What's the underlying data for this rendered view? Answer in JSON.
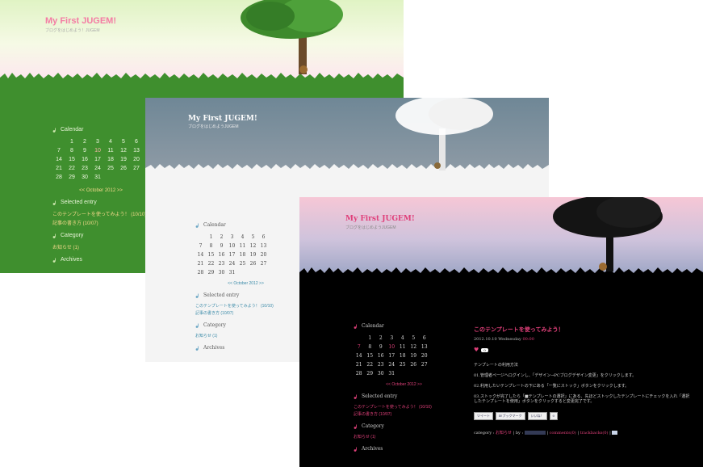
{
  "theme_spring": {
    "title": "My First JUGEM!",
    "subtitle": "ブログをはじめよう！JUGEM",
    "calendar_heading": "Calendar",
    "calendar_rows": [
      [
        "",
        "",
        "1",
        "2",
        "3",
        "4",
        "5",
        "6"
      ],
      [
        "7",
        "8",
        "9",
        "10",
        "11",
        "12",
        "13"
      ],
      [
        "14",
        "15",
        "16",
        "17",
        "18",
        "19",
        "20"
      ],
      [
        "21",
        "22",
        "23",
        "24",
        "25",
        "26",
        "27"
      ],
      [
        "28",
        "29",
        "30",
        "31",
        "",
        "",
        ""
      ]
    ],
    "calendar_nav": "<< October 2012 >>",
    "selected_heading": "Selected entry",
    "selected_items": [
      "このテンプレートを使ってみよう！ (10/10)",
      "記事の書き方 (10/07)"
    ],
    "category_heading": "Category",
    "category_items": [
      "お知らせ (1)"
    ],
    "archives_heading": "Archives"
  },
  "theme_winter": {
    "title": "My First JUGEM!",
    "subtitle": "ブログをはじめようJUGEM",
    "calendar_heading": "Calendar",
    "calendar_rows": [
      [
        "",
        "",
        "1",
        "2",
        "3",
        "4",
        "5",
        "6"
      ],
      [
        "7",
        "8",
        "9",
        "10",
        "11",
        "12",
        "13"
      ],
      [
        "14",
        "15",
        "16",
        "17",
        "18",
        "19",
        "20"
      ],
      [
        "21",
        "22",
        "23",
        "24",
        "25",
        "26",
        "27"
      ],
      [
        "28",
        "29",
        "30",
        "31",
        "",
        "",
        ""
      ]
    ],
    "calendar_nav": "<< October 2012 >>",
    "selected_heading": "Selected entry",
    "selected_items": [
      "このテンプレートを使ってみよう！ (10/10)",
      "記事の書き方 (10/07)"
    ],
    "category_heading": "Category",
    "category_items": [
      "お知らせ (1)"
    ],
    "archives_heading": "Archives"
  },
  "theme_night": {
    "title": "My First JUGEM!",
    "subtitle": "ブログをはじめようJUGEM",
    "calendar_heading": "Calendar",
    "calendar_rows": [
      [
        "",
        "1",
        "2",
        "3",
        "4",
        "5",
        "6"
      ],
      [
        "7",
        "8",
        "9",
        "10",
        "11",
        "12",
        "13"
      ],
      [
        "14",
        "15",
        "16",
        "17",
        "18",
        "19",
        "20"
      ],
      [
        "21",
        "22",
        "23",
        "24",
        "25",
        "26",
        "27"
      ],
      [
        "28",
        "29",
        "30",
        "31",
        "",
        "",
        ""
      ]
    ],
    "calendar_nav": "<< October 2012 >>",
    "selected_heading": "Selected entry",
    "selected_items": [
      "このテンプレートを使ってみよう！ (10/10)",
      "記事の書き方 (10/07)"
    ],
    "category_heading": "Category",
    "category_items": [
      "お知らせ (1)"
    ],
    "archives_heading": "Archives",
    "entry": {
      "title": "このテンプレートを使ってみよう！",
      "date": "2012.10.10 Wednesday",
      "time": "00:00",
      "like_count": "0",
      "paragraphs": [
        "テンプレートの利用方法",
        "01.管理者ページへログインし、「デザイン→PCブログデザイン変更」をクリックします。",
        "02.利用したいテンプレートの下にある「一覧にストック」ボタンをクリックします。",
        "03.ストックが完了したら「■テンプレートの選択」にある、先ほどストックしたテンプレートにチェックを入れ「選択したテンプレートを使用」ボタンをクリックすると変更完了です。"
      ],
      "social_buttons": [
        "ツイート",
        "B!ブックマーク",
        "いいね！",
        "0"
      ],
      "footer_category_label": "category :",
      "footer_category": "お知らせ",
      "footer_by": "by :",
      "footer_comments": "comments(0)",
      "footer_trackbacks": "trackbacks(0)"
    }
  },
  "colors": {
    "spring_green": "#3f8f2e",
    "spring_title": "#f47ca4",
    "winter_sky": "#6f8796",
    "night_accent": "#e0407a"
  }
}
